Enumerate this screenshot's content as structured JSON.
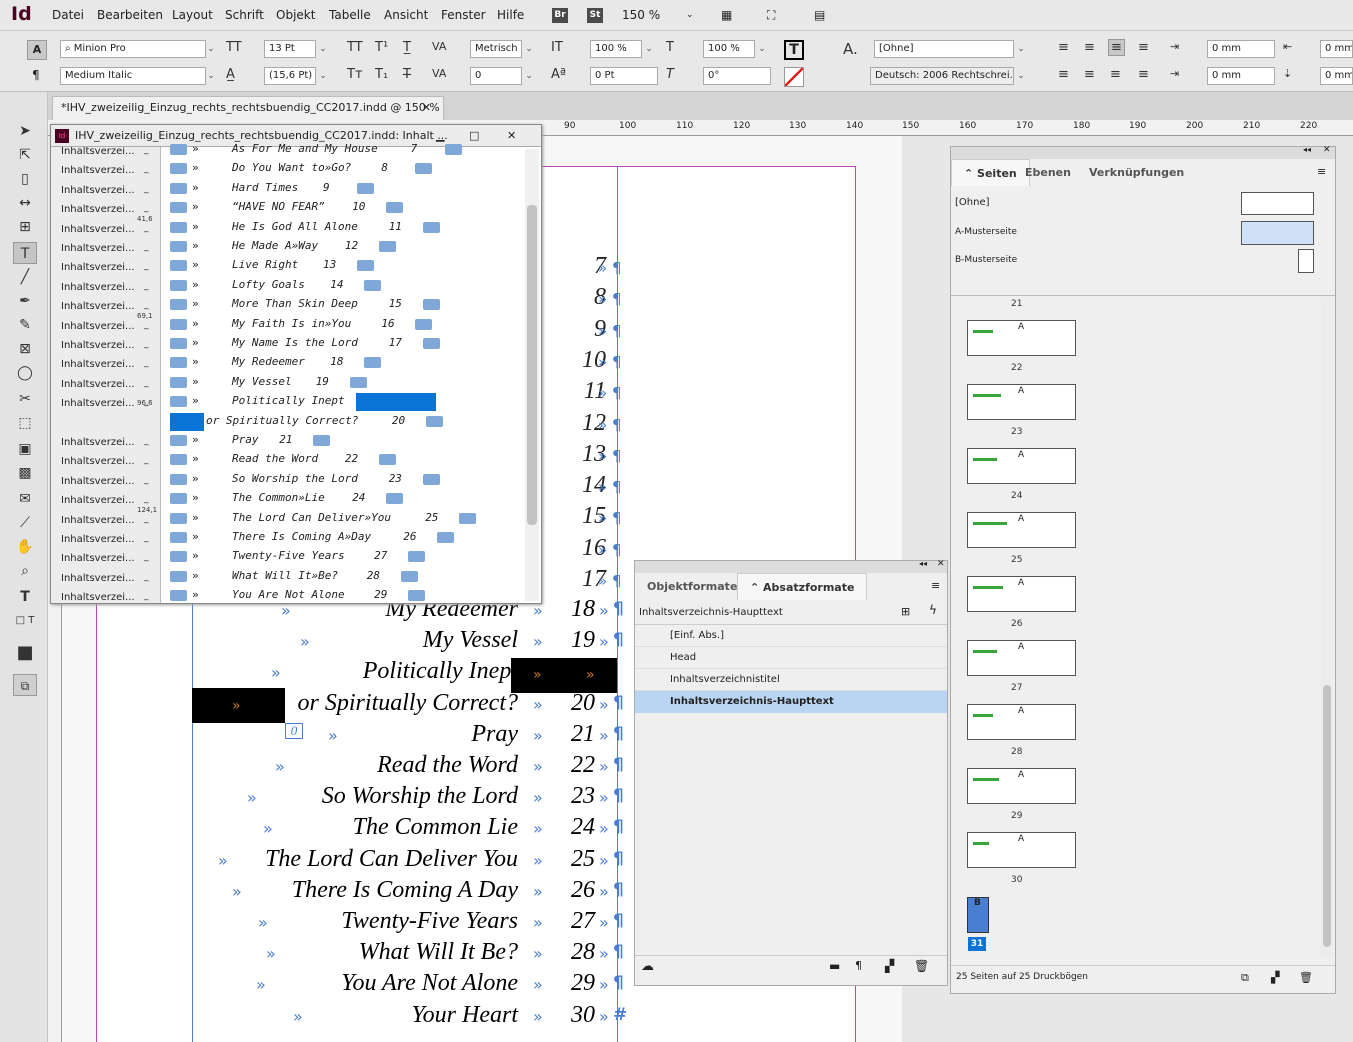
{
  "app": {
    "logo": "Id"
  },
  "menu": [
    "Datei",
    "Bearbeiten",
    "Layout",
    "Schrift",
    "Objekt",
    "Tabelle",
    "Ansicht",
    "Fenster",
    "Hilfe"
  ],
  "bridge_badges": [
    "Br",
    "St"
  ],
  "zoom": "150 %",
  "control": {
    "font_family": "Minion Pro",
    "font_style": "Medium Italic",
    "font_size": "13 Pt",
    "leading": "(15,6 Pt)",
    "kerning": "Metrisch",
    "tracking": "0",
    "vscale": "100 %",
    "hscale": "100 %",
    "baseline": "0 Pt",
    "skew": "0°",
    "char_style": "[Ohne]",
    "language": "Deutsch: 2006 Rechtschrei...",
    "indent_left": "0 mm",
    "indent_first": "0 mm",
    "indent_right": "0 mm",
    "space_before": "0 mm"
  },
  "doc_tab": "*IHV_zweizeilig_Einzug_rechts_rechtsbuendig_CC2017.indd @ 150 %",
  "ruler_marks": [
    "90",
    "100",
    "110",
    "120",
    "130",
    "140",
    "150",
    "160",
    "170",
    "180",
    "190",
    "200",
    "210",
    "220"
  ],
  "story_editor": {
    "title": "IHV_zweizeilig_Einzug_rechts_rechtsbuendig_CC2017.indd: Inhalt ...",
    "style_label": "Inhaltsverzei...",
    "rows": [
      {
        "text": "As For Me and My House",
        "num": "7"
      },
      {
        "text": "Do You Want to»Go?",
        "num": "8"
      },
      {
        "text": "Hard Times",
        "num": "9"
      },
      {
        "text": "“HAVE NO FEAR”",
        "num": "10"
      },
      {
        "text": "He Is God All Alone",
        "num": "11",
        "mark": "41,6"
      },
      {
        "text": "He Made A»Way",
        "num": "12"
      },
      {
        "text": "Live Right",
        "num": "13"
      },
      {
        "text": "Lofty Goals",
        "num": "14"
      },
      {
        "text": "More Than Skin Deep",
        "num": "15"
      },
      {
        "text": "My Faith Is in»You",
        "num": "16",
        "mark": "69,1"
      },
      {
        "text": "My Name Is the Lord",
        "num": "17"
      },
      {
        "text": "My Redeemer",
        "num": "18"
      },
      {
        "text": "My Vessel",
        "num": "19"
      },
      {
        "text": "Politically Inept",
        "num": ""
      },
      {
        "text": "or Spiritually Correct?",
        "num": "20",
        "mark": "96,6"
      },
      {
        "text": "Pray",
        "num": "21"
      },
      {
        "text": "Read the Word",
        "num": "22"
      },
      {
        "text": "So Worship the Lord",
        "num": "23"
      },
      {
        "text": "The Common»Lie",
        "num": "24"
      },
      {
        "text": "The Lord Can Deliver»You",
        "num": "25",
        "mark": "124,1"
      },
      {
        "text": "There Is Coming A»Day",
        "num": "26"
      },
      {
        "text": "Twenty-Five Years",
        "num": "27"
      },
      {
        "text": "What Will It»Be?",
        "num": "28"
      },
      {
        "text": "You Are Not Alone",
        "num": "29"
      }
    ]
  },
  "layout_text": {
    "numbers": [
      "7",
      "8",
      "9",
      "10",
      "11",
      "12",
      "13",
      "14",
      "15",
      "16",
      "17"
    ],
    "lines": [
      {
        "title": "My Redeemer",
        "num": "18"
      },
      {
        "title": "My Vessel",
        "num": "19"
      },
      {
        "title": "Politically Inept",
        "num": ""
      },
      {
        "title": "or Spiritually Correct?",
        "num": "20"
      },
      {
        "title": "Pray",
        "num": "21"
      },
      {
        "title": "Read the Word",
        "num": "22"
      },
      {
        "title": "So Worship the Lord",
        "num": "23"
      },
      {
        "title": "The Common Lie",
        "num": "24"
      },
      {
        "title": "The Lord Can Deliver You",
        "num": "25"
      },
      {
        "title": "There Is Coming A Day",
        "num": "26"
      },
      {
        "title": "Twenty-Five Years",
        "num": "27"
      },
      {
        "title": "What Will It Be?",
        "num": "28"
      },
      {
        "title": "You Are Not Alone",
        "num": "29"
      },
      {
        "title": "Your Heart",
        "num": "30"
      }
    ],
    "overset_marker": "0"
  },
  "absatz_panel": {
    "tabs": [
      "Objektformate",
      "Absatzformate"
    ],
    "current": "Inhaltsverzeichnis-Haupttext",
    "styles": [
      "[Einf. Abs.]",
      "Head",
      "Inhaltsverzeichnistitel",
      "Inhaltsverzeichnis-Haupttext"
    ]
  },
  "seiten_panel": {
    "tabs": [
      "Seiten",
      "Ebenen",
      "Verknüpfungen"
    ],
    "masters": [
      "[Ohne]",
      "A-Musterseite",
      "B-Musterseite"
    ],
    "pages": [
      "21",
      "22",
      "23",
      "24",
      "25",
      "26",
      "27",
      "28",
      "29",
      "30"
    ],
    "page_master_prefix": "A",
    "last_page": "31",
    "last_page_master": "B",
    "footer": "25 Seiten auf 25 Druckbögen"
  },
  "colors": {
    "accent_blue": "#0a74d6",
    "selection": "#b9d5f3",
    "frame_magenta": "#bb44bb",
    "thumb_green": "#3aa63a"
  }
}
